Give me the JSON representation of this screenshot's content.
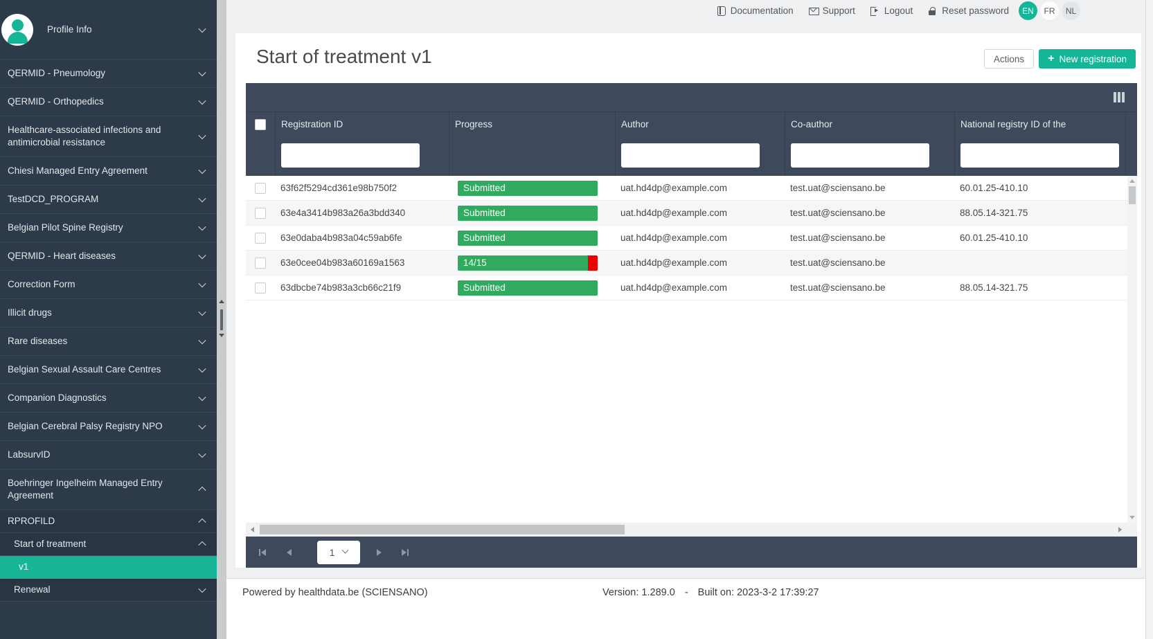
{
  "topbar": {
    "links": [
      {
        "id": "documentation",
        "label": "Documentation",
        "icon": "book-icon"
      },
      {
        "id": "support",
        "label": "Support",
        "icon": "envelope-icon"
      },
      {
        "id": "logout",
        "label": "Logout",
        "icon": "logout-icon"
      },
      {
        "id": "reset-password",
        "label": "Reset password",
        "icon": "lock-icon"
      }
    ],
    "languages": [
      {
        "code": "EN",
        "active": true
      },
      {
        "code": "FR",
        "active": false
      },
      {
        "code": "NL",
        "active": false
      }
    ]
  },
  "sidebar": {
    "profile_label": "Profile Info",
    "items": [
      {
        "label": "QERMID - Pneumology",
        "state": "collapsed",
        "level": 0
      },
      {
        "label": "QERMID - Orthopedics",
        "state": "collapsed",
        "level": 0
      },
      {
        "label": "Healthcare-associated infections and antimicrobial resistance",
        "state": "collapsed",
        "level": 0
      },
      {
        "label": "Chiesi Managed Entry Agreement",
        "state": "collapsed",
        "level": 0
      },
      {
        "label": "TestDCD_PROGRAM",
        "state": "collapsed",
        "level": 0
      },
      {
        "label": "Belgian Pilot Spine Registry",
        "state": "collapsed",
        "level": 0
      },
      {
        "label": "QERMID - Heart diseases",
        "state": "collapsed",
        "level": 0
      },
      {
        "label": "Correction Form",
        "state": "collapsed",
        "level": 0
      },
      {
        "label": "Illicit drugs",
        "state": "collapsed",
        "level": 0
      },
      {
        "label": "Rare diseases",
        "state": "collapsed",
        "level": 0
      },
      {
        "label": "Belgian Sexual Assault Care Centres",
        "state": "collapsed",
        "level": 0
      },
      {
        "label": "Companion Diagnostics",
        "state": "collapsed",
        "level": 0
      },
      {
        "label": "Belgian Cerebral Palsy Registry NPO",
        "state": "collapsed",
        "level": 0
      },
      {
        "label": "LabsurvID",
        "state": "collapsed",
        "level": 0
      },
      {
        "label": "Boehringer Ingelheim Managed Entry Agreement",
        "state": "expanded",
        "level": 0
      },
      {
        "label": "RPROFILD",
        "state": "expanded",
        "level": 1,
        "group": true
      },
      {
        "label": "Start of treatment",
        "state": "expanded",
        "level": 2,
        "group": true
      },
      {
        "label": "v1",
        "state": "none",
        "level": 3,
        "group": true,
        "selected": true
      },
      {
        "label": "Renewal",
        "state": "collapsed",
        "level": 2,
        "group": true
      }
    ]
  },
  "main": {
    "title": "Start of treatment v1",
    "actions_label": "Actions",
    "new_registration_label": "New registration",
    "plus_glyph": "+"
  },
  "table": {
    "columns": [
      {
        "label": "Registration ID",
        "key": "registration-id",
        "filter": true
      },
      {
        "label": "Progress",
        "key": "progress",
        "filter": false
      },
      {
        "label": "Author",
        "key": "author",
        "filter": true
      },
      {
        "label": "Co-author",
        "key": "co-author",
        "filter": true
      },
      {
        "label": "National registry ID of the",
        "key": "national-registry-id",
        "filter": true
      }
    ],
    "rows": [
      {
        "registration_id": "63f62f5294cd361e98b750f2",
        "progress": {
          "label": "Submitted",
          "percent": 100
        },
        "author": "uat.hd4dp@example.com",
        "co_author": "test.uat@sciensano.be",
        "national_registry_id": "60.01.25-410.10"
      },
      {
        "registration_id": "63e4a3414b983a26a3bdd340",
        "progress": {
          "label": "Submitted",
          "percent": 100
        },
        "author": "uat.hd4dp@example.com",
        "co_author": "test.uat@sciensano.be",
        "national_registry_id": "88.05.14-321.75"
      },
      {
        "registration_id": "63e0daba4b983a04c59ab6fe",
        "progress": {
          "label": "Submitted",
          "percent": 100
        },
        "author": "uat.hd4dp@example.com",
        "co_author": "test.uat@sciensano.be",
        "national_registry_id": "60.01.25-410.10"
      },
      {
        "registration_id": "63e0cee04b983a60169a1563",
        "progress": {
          "label": "14/15",
          "percent": 93
        },
        "author": "uat.hd4dp@example.com",
        "co_author": "test.uat@sciensano.be",
        "national_registry_id": ""
      },
      {
        "registration_id": "63dbcbe74b983a3cb66c21f9",
        "progress": {
          "label": "Submitted",
          "percent": 100
        },
        "author": "uat.hd4dp@example.com",
        "co_author": "test.uat@sciensano.be",
        "national_registry_id": "88.05.14-321.75"
      }
    ]
  },
  "pagination": {
    "current_page": "1"
  },
  "footer": {
    "powered_by": "Powered by healthdata.be (SCIENSANO)",
    "version": "Version: 1.289.0",
    "separator": "-",
    "built": "Built on: 2023-3-2 17:39:27"
  },
  "colors": {
    "accent_green": "#17b598",
    "progress_green": "#2faa5e",
    "progress_red": "#ee0000",
    "sidebar_bg": "#2d3a4a",
    "grid_header_bg": "#3e4a5c"
  }
}
